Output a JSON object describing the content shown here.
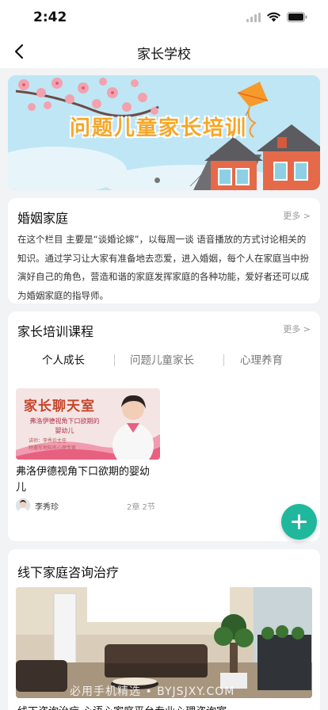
{
  "status_bar": {
    "time": "2:42"
  },
  "nav": {
    "title": "家长学校"
  },
  "banner": {
    "title": "问题儿童家长培训"
  },
  "marriage": {
    "title": "婚姻家庭",
    "more": "更多 >",
    "description": "在这个栏目 主要是“谈婚论嫁”，以每周一谈 语音播放的方式讨论相关的知识。通过学习让大家有准备地去恋爱，进入婚姻，每个人在家庭当中扮演好自己的角色，营造和谐的家庭发挥家庭的各种功能，爱好者还可以成为婚姻家庭的指导师。"
  },
  "courses": {
    "title": "家长培训课程",
    "more": "更多 >",
    "tabs": [
      "个人成长",
      "问题儿童家长",
      "心理养育"
    ],
    "item": {
      "thumb_title": "家长聊天室",
      "thumb_subtitle": "弗洛伊德视角下口欲期的婴幼儿",
      "thumb_speaker": "讲师：李秀珍主任",
      "thumb_speaker_title": "特邀军地知名心理专家",
      "name": "弗洛伊德视角下口欲期的婴幼儿",
      "teacher": "李秀珍",
      "chapters": "2章 2节"
    }
  },
  "offline": {
    "title": "线下家庭咨询治疗",
    "description": "线下咨询治疗 心语心家庭平台专业心理咨询室"
  },
  "watermark": "必用手机精选 • BYJSJXY.COM",
  "colors": {
    "accent": "#1fb89d",
    "banner_text": "#f7a626"
  }
}
